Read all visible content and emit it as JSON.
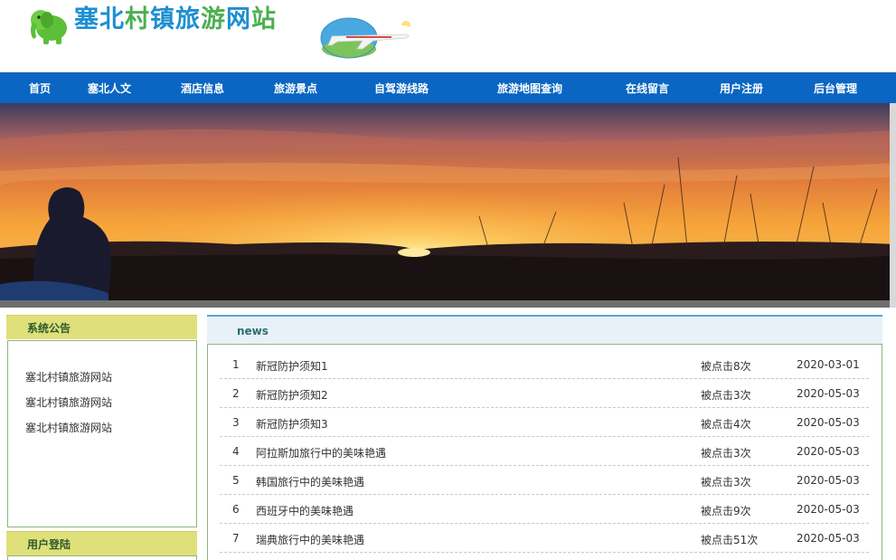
{
  "header": {
    "title_chars": [
      "塞",
      "北",
      "村",
      "镇",
      "旅",
      "游",
      "网",
      "站"
    ],
    "title_colors": [
      "#1e8fd0",
      "#1e8fd0",
      "#4caf50",
      "#1e8fd0",
      "#1e8fd0",
      "#4caf50",
      "#1e8fd0",
      "#4caf50"
    ]
  },
  "nav": {
    "items": [
      "首页",
      "塞北人文",
      "酒店信息",
      "旅游景点",
      "自驾游线路",
      "旅游地图查询",
      "在线留言",
      "用户注册",
      "后台管理"
    ]
  },
  "sidebar": {
    "notice_heading": "系统公告",
    "notices": [
      "塞北村镇旅游网站",
      "塞北村镇旅游网站",
      "塞北村镇旅游网站"
    ],
    "login_heading": "用户登陆"
  },
  "news": {
    "heading": "news",
    "rows": [
      {
        "num": "1",
        "title": "新冠防护须知1",
        "clicks": "被点击8次",
        "date": "2020-03-01"
      },
      {
        "num": "2",
        "title": "新冠防护须知2",
        "clicks": "被点击3次",
        "date": "2020-05-03"
      },
      {
        "num": "3",
        "title": "新冠防护须知3",
        "clicks": "被点击4次",
        "date": "2020-05-03"
      },
      {
        "num": "4",
        "title": "阿拉斯加旅行中的美味艳遇",
        "clicks": "被点击3次",
        "date": "2020-05-03"
      },
      {
        "num": "5",
        "title": "韩国旅行中的美味艳遇",
        "clicks": "被点击3次",
        "date": "2020-05-03"
      },
      {
        "num": "6",
        "title": "西班牙中的美味艳遇",
        "clicks": "被点击9次",
        "date": "2020-05-03"
      },
      {
        "num": "7",
        "title": "瑞典旅行中的美味艳遇",
        "clicks": "被点击51次",
        "date": "2020-05-03"
      }
    ]
  },
  "colors": {
    "nav_bg": "#0a66c2",
    "sidebar_head_bg": "#e0e07a",
    "news_heading": "#2c6f6f",
    "box_border": "#8fb57a"
  },
  "icons": {
    "logo": "elephant-logo-icon",
    "badge": "airplane-badge-icon"
  }
}
